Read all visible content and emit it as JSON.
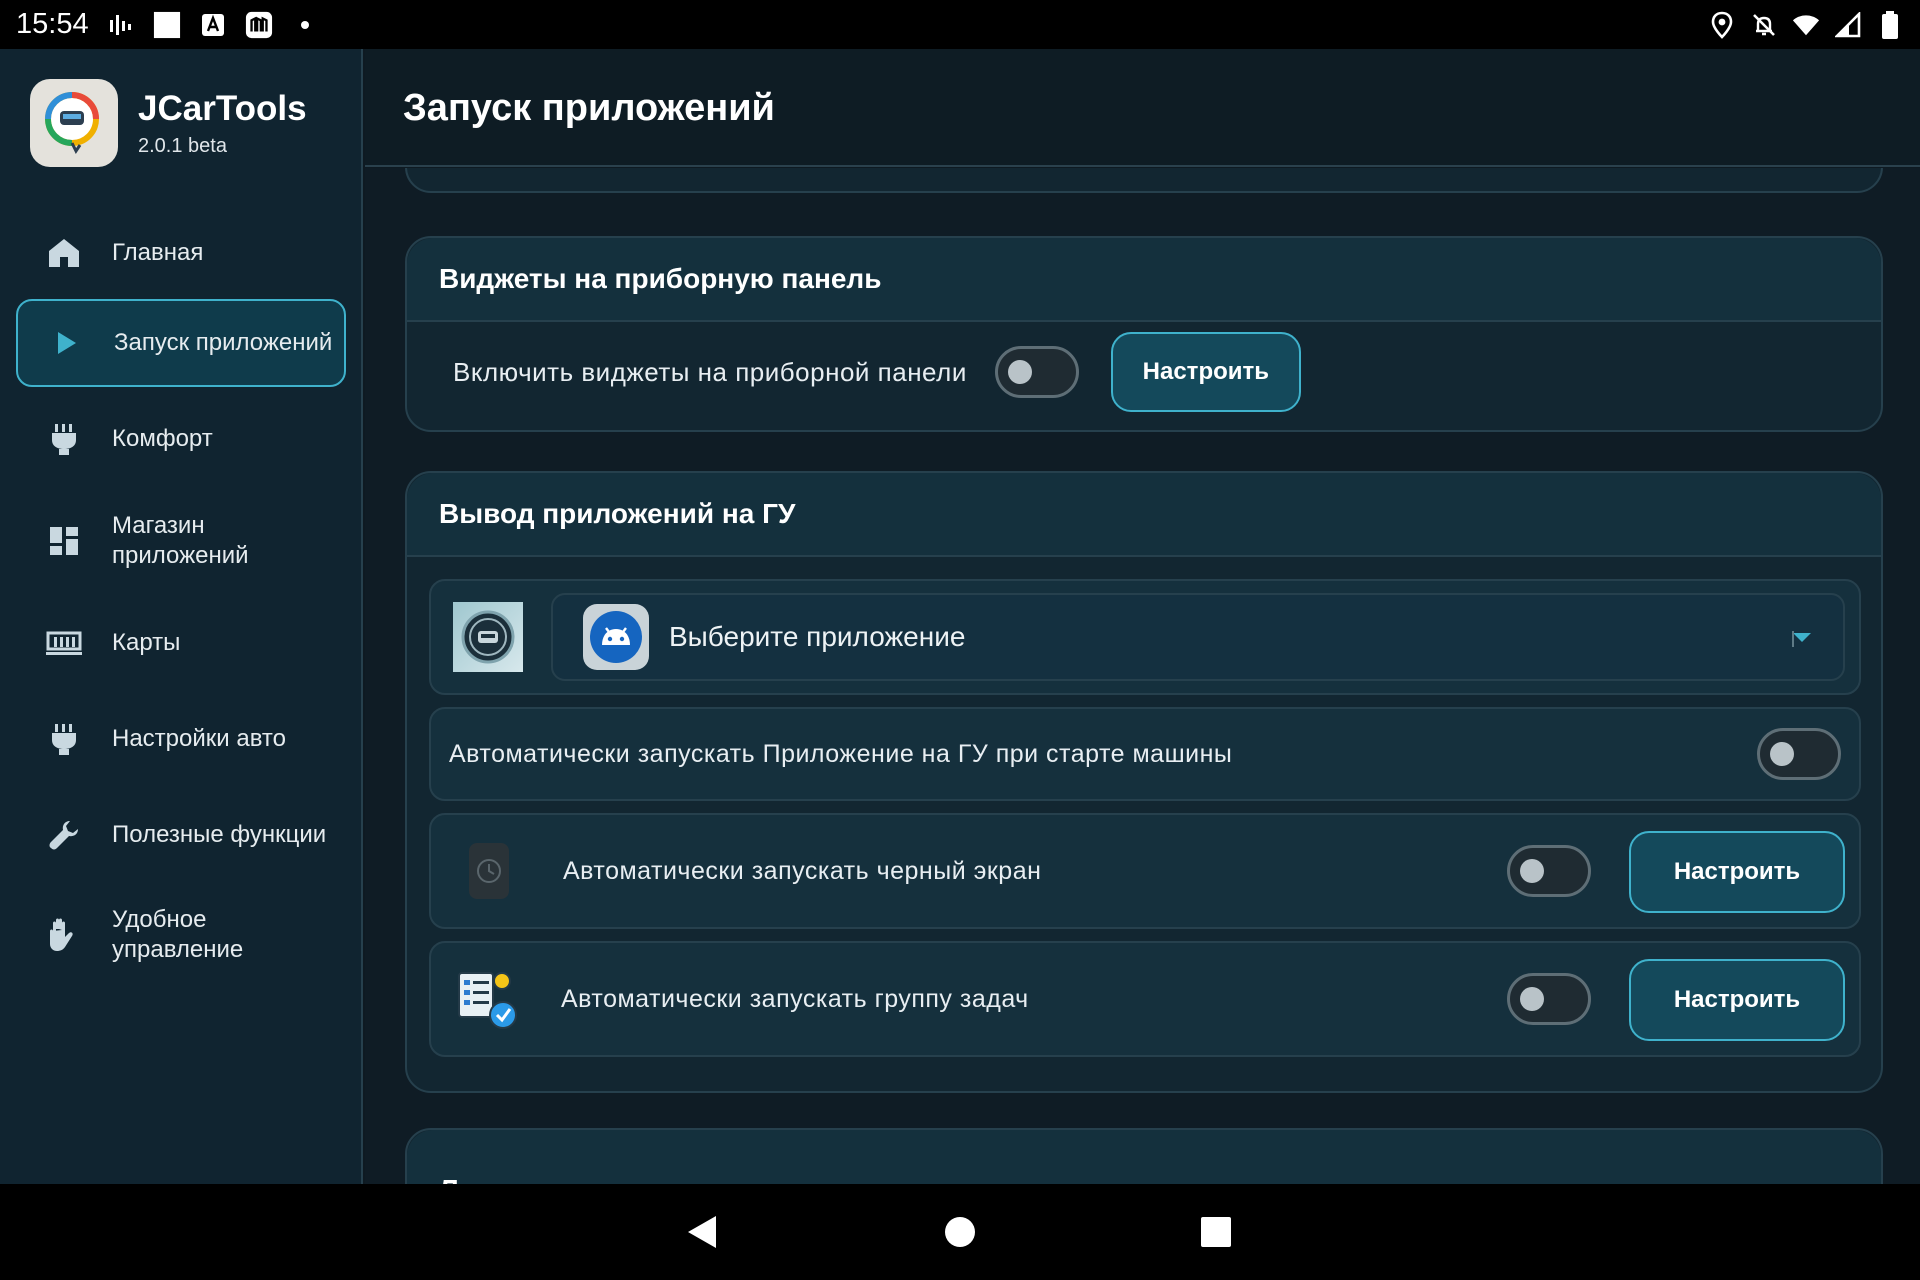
{
  "status_bar": {
    "time": "15:54"
  },
  "app": {
    "name": "JCarTools",
    "version": "2.0.1 beta"
  },
  "sidebar": {
    "items": [
      {
        "label": "Главная",
        "icon": "home-icon"
      },
      {
        "label": "Запуск приложений",
        "icon": "play-icon",
        "active": true
      },
      {
        "label": "Комфорт",
        "icon": "plug-icon"
      },
      {
        "label_line1": "Магазин",
        "label_line2": "приложений",
        "icon": "dashboard-icon"
      },
      {
        "label": "Карты",
        "icon": "map-icon"
      },
      {
        "label": "Настройки авто",
        "icon": "plug-icon"
      },
      {
        "label": "Полезные функции",
        "icon": "wrench-icon"
      },
      {
        "label_line1": "Удобное",
        "label_line2": "управление",
        "icon": "hand-icon"
      }
    ]
  },
  "header": {
    "title": "Запуск приложений"
  },
  "widgets_card": {
    "title": "Виджеты на приборную панель",
    "toggle_label": "Включить виджеты на приборной панели",
    "button_label": "Настроить"
  },
  "head_unit_card": {
    "title": "Вывод приложений на ГУ",
    "select_placeholder": "Выберите приложение",
    "autostart_label": "Автоматически запускать Приложение на ГУ при старте машины",
    "black_screen_label": "Автоматически запускать черный экран",
    "black_screen_button": "Настроить",
    "task_group_label": "Автоматически запускать группу задач",
    "task_group_button": "Настроить"
  },
  "launcher_card": {
    "title": "Лаунчер"
  },
  "colors": {
    "accent": "#3fb2cc",
    "background": "#0e1a22",
    "card": "#122631"
  }
}
